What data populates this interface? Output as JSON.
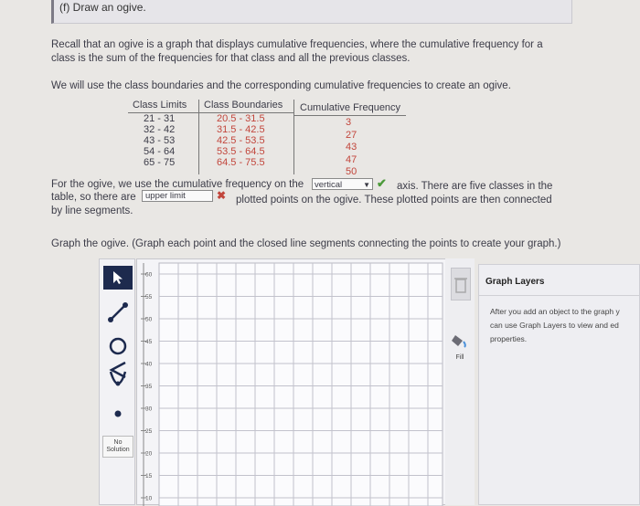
{
  "header": {
    "title": "(f) Draw an ogive."
  },
  "intro": {
    "line1": "Recall that an ogive is a graph that displays cumulative frequencies, where the cumulative frequency for a",
    "line2": "class is the sum of the frequencies for that class and all the previous classes.",
    "line3": "We will use the class boundaries and the corresponding cumulative frequencies to create an ogive."
  },
  "table": {
    "headers": [
      "Class Limits",
      "Class Boundaries",
      "Cumulative Frequency"
    ],
    "limits": [
      "21 - 31",
      "32 - 42",
      "43 - 53",
      "54 - 64",
      "65 - 75"
    ],
    "boundaries": [
      "20.5 - 31.5",
      "31.5 - 42.5",
      "42.5 - 53.5",
      "53.5 - 64.5",
      "64.5 - 75.5"
    ],
    "cumulative": [
      "3",
      "27",
      "43",
      "47",
      "50"
    ]
  },
  "question": {
    "line1_prefix": "For the ogive, we use the cumulative frequency on the",
    "axis_selected": "vertical",
    "line1_suffix": "axis. There are five classes in the",
    "line2_prefix": "table, so there are",
    "points_value": "upper limit",
    "line2_suffix": "plotted points on the ogive. These plotted points are then connected",
    "line3": "by line segments."
  },
  "instruction": "Graph the ogive. (Graph each point and the closed line segments connecting the points to create your graph.)",
  "toolbar": {
    "no_solution_line1": "No",
    "no_solution_line2": "Solution"
  },
  "graph": {
    "y_ticks": [
      "60",
      "55",
      "50",
      "45",
      "40",
      "35",
      "30",
      "25",
      "20",
      "15",
      "10"
    ]
  },
  "fill_label": "Fill",
  "layers": {
    "title": "Graph Layers",
    "body1": "After you add an object to the graph y",
    "body2": "can use Graph Layers to view and ed",
    "body3": "properties."
  }
}
